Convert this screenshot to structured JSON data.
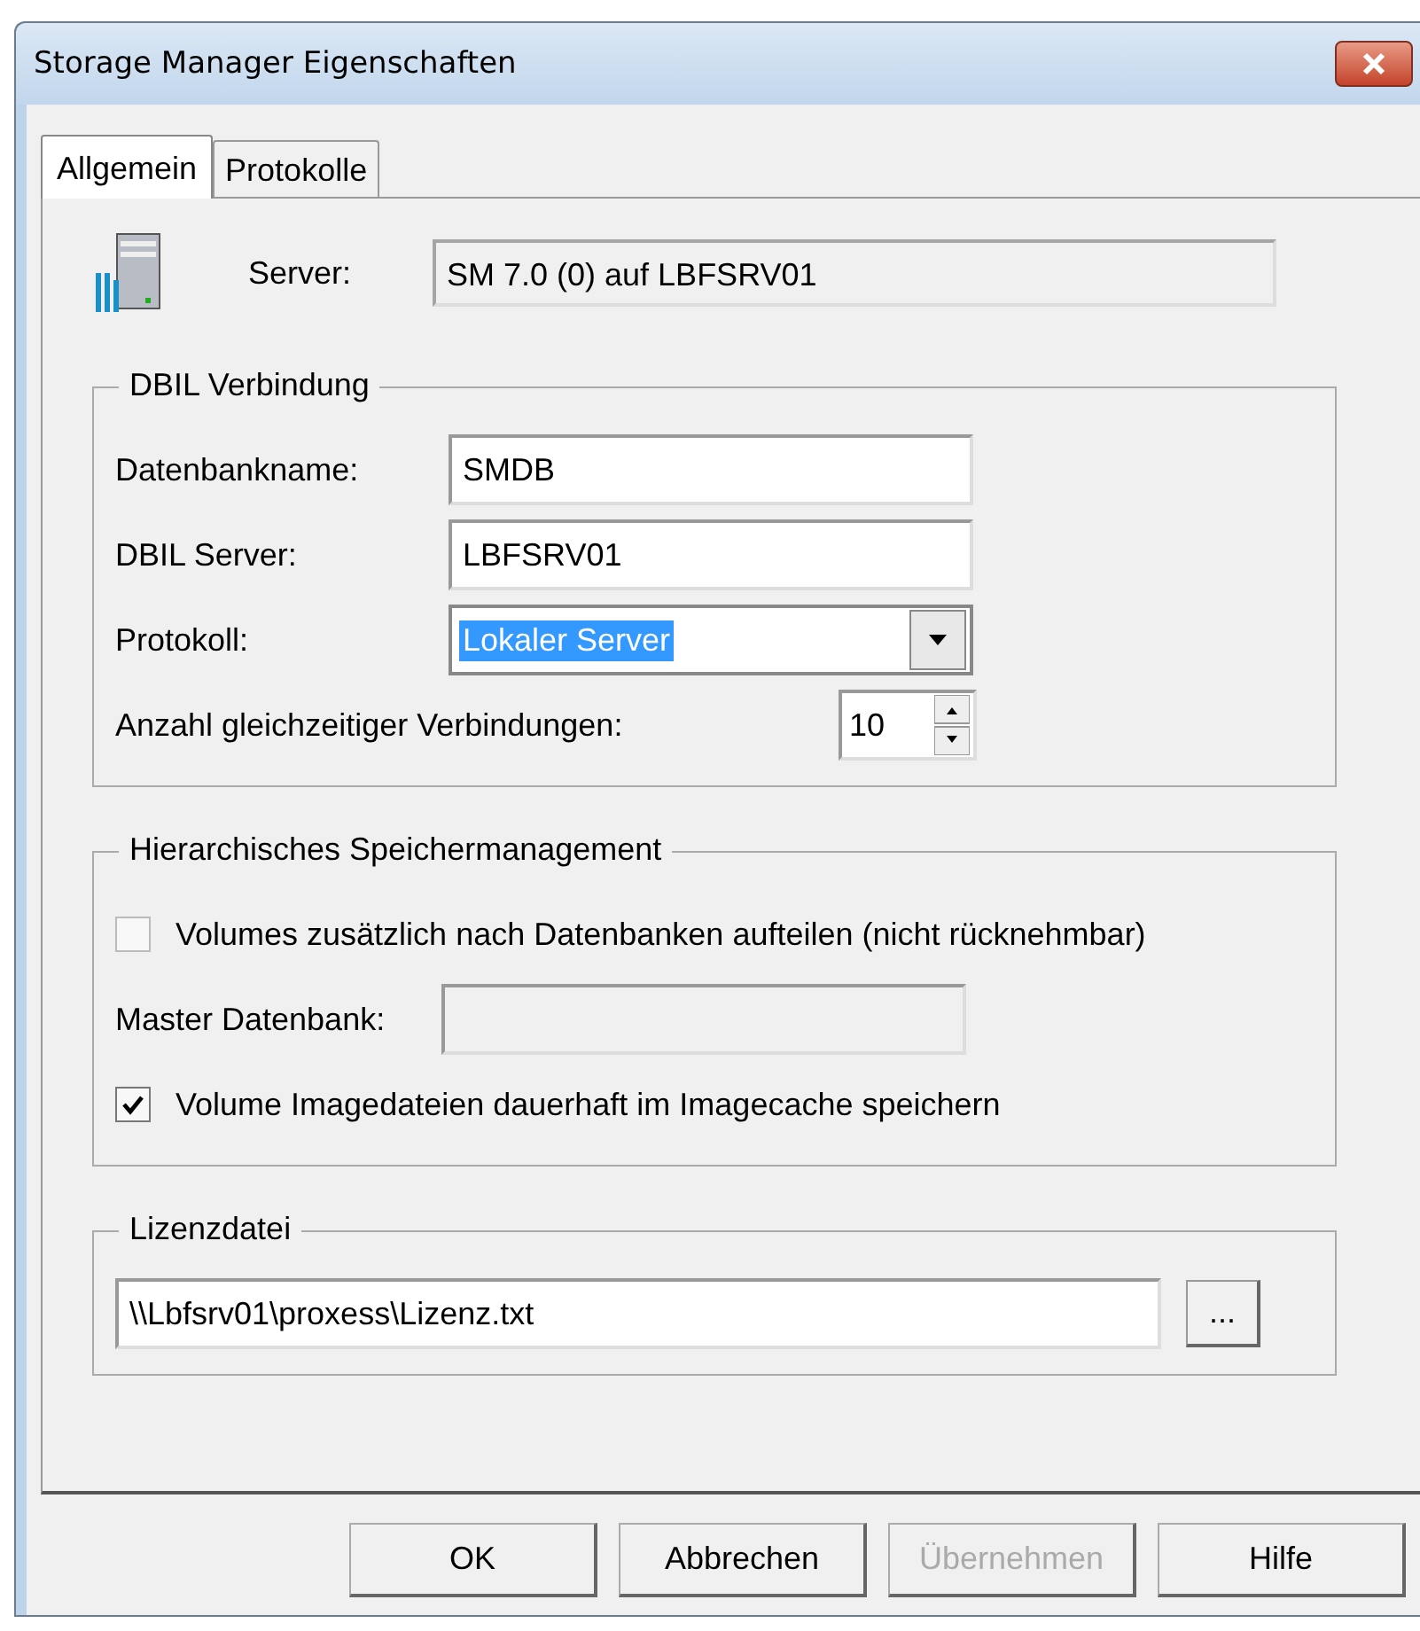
{
  "window": {
    "title": "Storage Manager Eigenschaften"
  },
  "tabs": [
    {
      "label": "Allgemein",
      "selected": true
    },
    {
      "label": "Protokolle",
      "selected": false
    }
  ],
  "server": {
    "label": "Server:",
    "value": "SM 7.0 (0) auf LBFSRV01"
  },
  "dbil": {
    "title": "DBIL Verbindung",
    "database": {
      "label": "Datenbankname:",
      "value": "SMDB"
    },
    "server": {
      "label": "DBIL Server:",
      "value": "LBFSRV01"
    },
    "protocol": {
      "label": "Protokoll:",
      "value": "Lokaler Server"
    },
    "connections": {
      "label": "Anzahl gleichzeitiger Verbindungen:",
      "value": "10"
    }
  },
  "hsm": {
    "title": "Hierarchisches Speichermanagement",
    "split": {
      "label": "Volumes zusätzlich nach Datenbanken aufteilen (nicht rücknehmbar)",
      "checked": false
    },
    "master": {
      "label": "Master Datenbank:",
      "disabled": true
    },
    "keep": {
      "label": "Volume Imagedateien dauerhaft im Imagecache speichern",
      "checked": true
    }
  },
  "license": {
    "title": "Lizenzdatei",
    "value": "\\\\Lbfsrv01\\proxess\\Lizenz.txt",
    "browse": "..."
  },
  "buttons": [
    {
      "label": "OK",
      "disabled": false
    },
    {
      "label": "Abbrechen",
      "disabled": false
    },
    {
      "label": "Übernehmen",
      "disabled": true
    },
    {
      "label": "Hilfe",
      "disabled": false
    }
  ]
}
